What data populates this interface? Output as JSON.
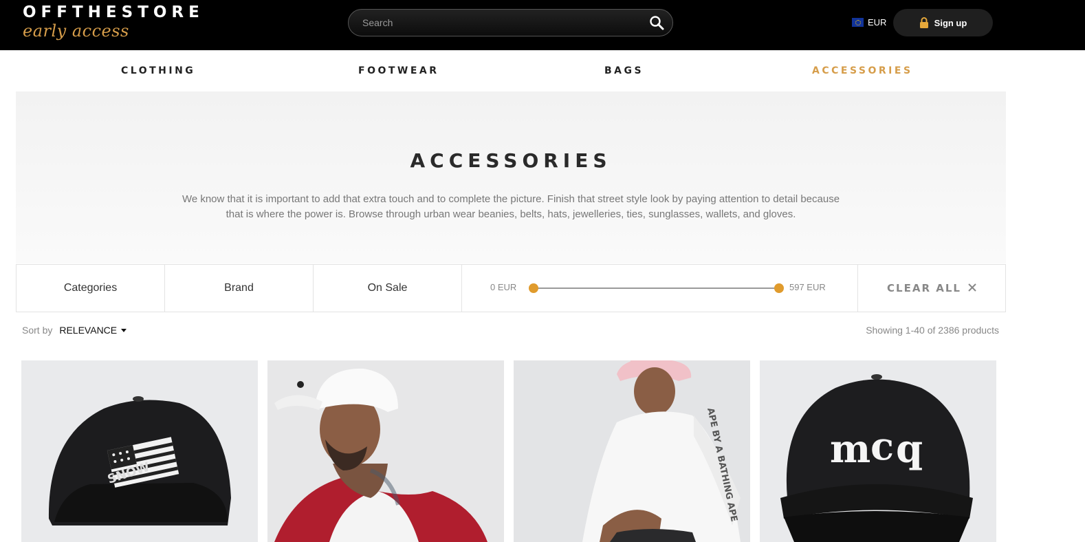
{
  "header": {
    "logo_main": "OFFTHESTORE",
    "logo_sub": "early access",
    "search_placeholder": "Search",
    "currency": "EUR",
    "signup_label": "Sign up"
  },
  "nav": {
    "items": [
      {
        "label": "CLOTHING"
      },
      {
        "label": "FOOTWEAR"
      },
      {
        "label": "BAGS"
      },
      {
        "label": "ACCESSORIES"
      }
    ],
    "active": "ACCESSORIES",
    "accent_color": "#d69d4a"
  },
  "hero": {
    "title": "ACCESSORIES",
    "description": "We know that it is important to add that extra touch and to complete the picture. Finish that street style look by paying attention to detail because that is where the power is. Browse through urban wear beanies, belts, hats, jewelleries, ties, sunglasses, wallets, and gloves."
  },
  "filters": {
    "categories": "Categories",
    "brand": "Brand",
    "on_sale": "On Sale",
    "price_min": "0 EUR",
    "price_max": "597 EUR",
    "clear_all": "CLEAR ALL"
  },
  "sort": {
    "label": "Sort by",
    "value": "RELEVANCE"
  },
  "results": {
    "showing": "Showing 1-40 of 2386 products"
  },
  "products": [
    {
      "icon": "black-cap-with-flag-patch"
    },
    {
      "icon": "model-white-cap-red-jacket"
    },
    {
      "icon": "model-pink-cap-white-longsleeve"
    },
    {
      "icon": "black-cap-mcq-logo"
    }
  ]
}
